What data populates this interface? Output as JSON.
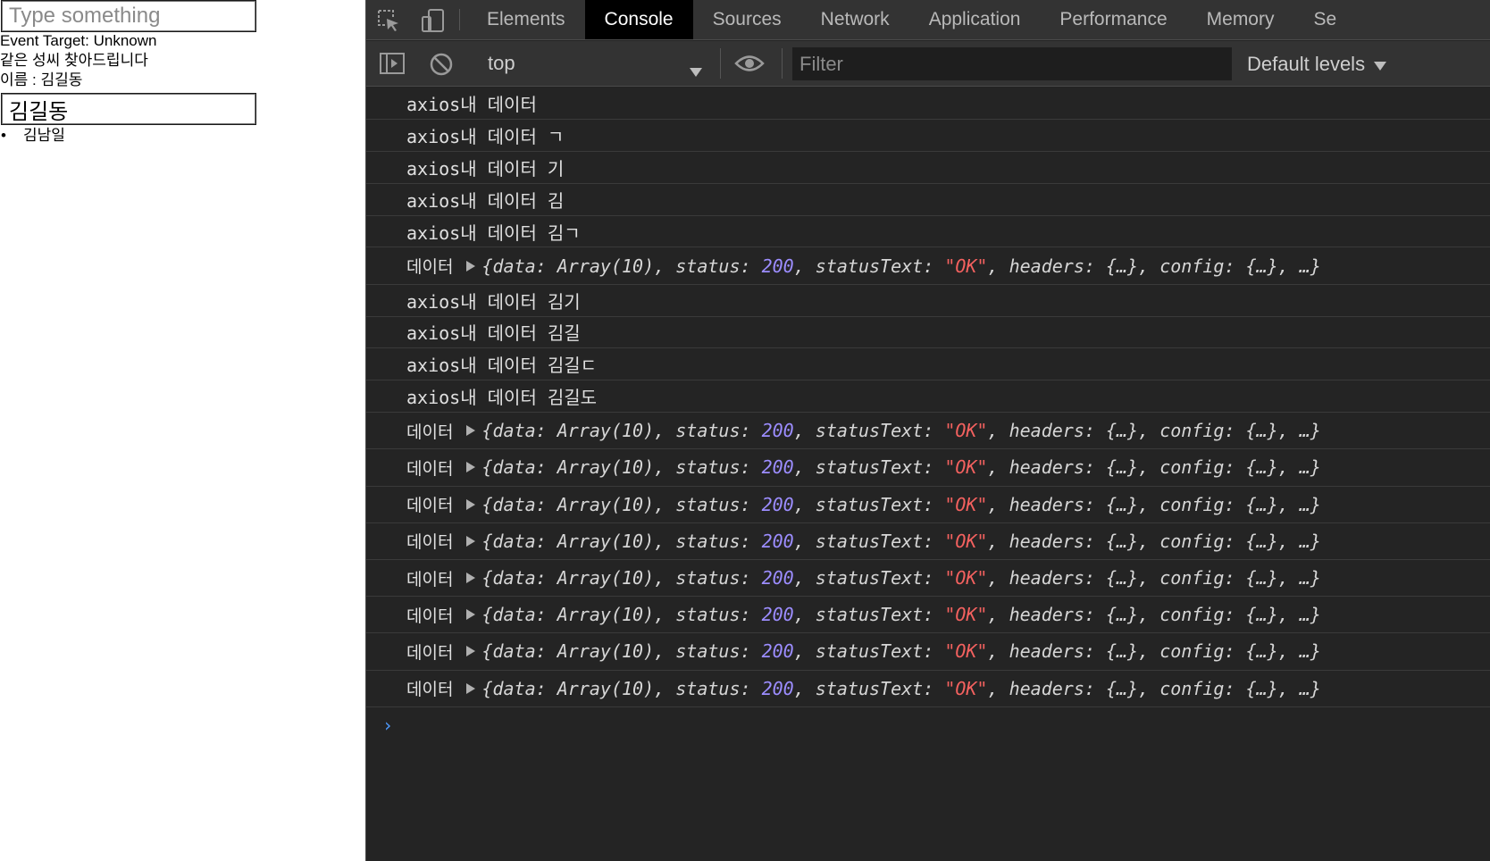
{
  "page": {
    "search_input": {
      "value": "",
      "placeholder": "Type something"
    },
    "event_target_text": "Event Target: Unknown",
    "same_surname_text": "같은 성씨 찾아드립니다",
    "name_text": "이름 : 김길동",
    "name_input": {
      "value": "김길동",
      "placeholder": ""
    },
    "results": [
      "김남일"
    ]
  },
  "devtools": {
    "tabs": [
      "Elements",
      "Console",
      "Sources",
      "Network",
      "Application",
      "Performance",
      "Memory",
      "Se"
    ],
    "active_tab": "Console",
    "toolbar": {
      "context": "top",
      "filter_placeholder": "Filter",
      "levels": "Default levels"
    },
    "log": [
      {
        "kind": "text",
        "text": "axios내 데이터"
      },
      {
        "kind": "text",
        "text": "axios내 데이터 ㄱ"
      },
      {
        "kind": "text",
        "text": "axios내 데이터 기"
      },
      {
        "kind": "text",
        "text": "axios내 데이터 김"
      },
      {
        "kind": "text",
        "text": "axios내 데이터 김ㄱ"
      },
      {
        "kind": "obj",
        "label": "데이터"
      },
      {
        "kind": "text",
        "text": "axios내 데이터 김기"
      },
      {
        "kind": "text",
        "text": "axios내 데이터 김길"
      },
      {
        "kind": "text",
        "text": "axios내 데이터 김길ㄷ"
      },
      {
        "kind": "text",
        "text": "axios내 데이터 김길도"
      },
      {
        "kind": "obj",
        "label": "데이터"
      },
      {
        "kind": "obj",
        "label": "데이터"
      },
      {
        "kind": "obj",
        "label": "데이터"
      },
      {
        "kind": "obj",
        "label": "데이터"
      },
      {
        "kind": "obj",
        "label": "데이터"
      },
      {
        "kind": "obj",
        "label": "데이터"
      },
      {
        "kind": "obj",
        "label": "데이터"
      },
      {
        "kind": "obj",
        "label": "데이터"
      }
    ],
    "response_preview": {
      "open": "{",
      "data_key": "data",
      "data_val": "Array(10)",
      "status_key": "status",
      "status_val": "200",
      "statusText_key": "statusText",
      "statusText_val": "\"OK\"",
      "headers_key": "headers",
      "headers_val": "{…}",
      "config_key": "config",
      "config_val": "{…}",
      "tail": "…}"
    },
    "prompt": "›",
    "colors": {
      "number": "#9c8dff",
      "string": "#f3615f",
      "prompt": "#4e9bff",
      "active_tab_bg": "#000000"
    },
    "icons": [
      "inspect-element-icon",
      "device-toolbar-icon",
      "sidebar-toggle-icon",
      "clear-console-icon",
      "eye-icon"
    ]
  }
}
